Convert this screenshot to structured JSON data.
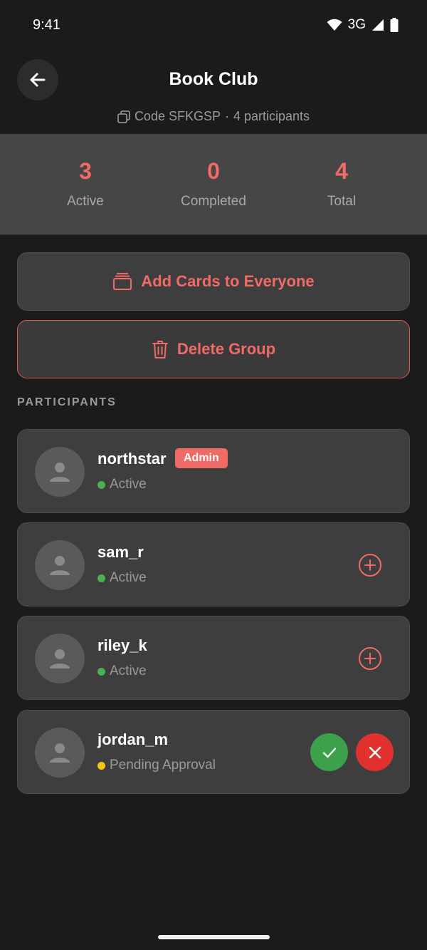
{
  "status_bar": {
    "time": "9:41",
    "network": "3G"
  },
  "header": {
    "title": "Book Club",
    "code_text": "Code SFKGSP",
    "separator": "·",
    "participants_text": "4 participants"
  },
  "stats": [
    {
      "value": "3",
      "label": "Active"
    },
    {
      "value": "0",
      "label": "Completed"
    },
    {
      "value": "4",
      "label": "Total"
    }
  ],
  "actions": {
    "add_cards_label": "Add Cards to Everyone",
    "delete_group_label": "Delete Group"
  },
  "participants_section": {
    "heading": "PARTICIPANTS"
  },
  "participants": [
    {
      "name": "northstar",
      "badge": "Admin",
      "status": "Active",
      "status_color": "#4caf50"
    },
    {
      "name": "sam_r",
      "status": "Active",
      "status_color": "#4caf50"
    },
    {
      "name": "riley_k",
      "status": "Active",
      "status_color": "#4caf50"
    },
    {
      "name": "jordan_m",
      "status": "Pending Approval",
      "status_color": "#f5c518"
    }
  ],
  "colors": {
    "accent": "#f06a66",
    "approve": "#3ca14a",
    "reject": "#e0312e",
    "background": "#1b1b1b"
  }
}
